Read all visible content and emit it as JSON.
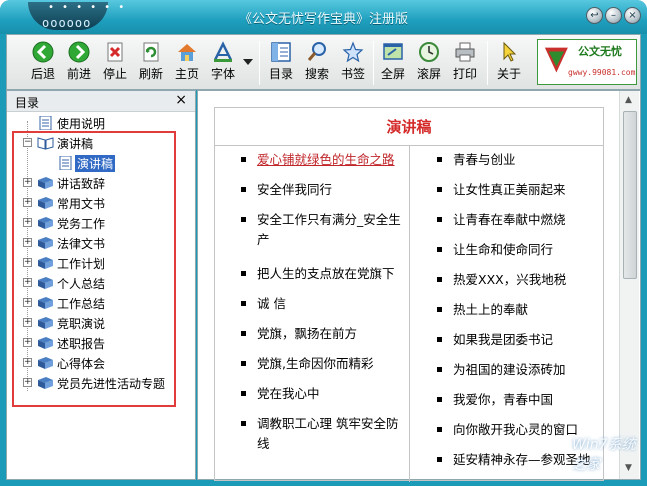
{
  "window": {
    "title": "《公文无忧写作宝典》注册版",
    "dots_top": "• • • • • •",
    "dots_bottom": "oooooo"
  },
  "window_controls": [
    {
      "name": "back-circle",
      "glyph": "↩"
    },
    {
      "name": "minimize",
      "glyph": "–"
    },
    {
      "name": "close",
      "glyph": "×"
    }
  ],
  "toolbar": {
    "buttons": [
      {
        "label": "后退",
        "icon": "back-arrow-icon"
      },
      {
        "label": "前进",
        "icon": "forward-arrow-icon"
      },
      {
        "label": "停止",
        "icon": "stop-icon"
      },
      {
        "label": "刷新",
        "icon": "refresh-icon"
      },
      {
        "label": "主页",
        "icon": "home-icon"
      },
      {
        "label": "字体",
        "icon": "font-icon"
      },
      {
        "label": "目录",
        "icon": "contents-icon"
      },
      {
        "label": "搜索",
        "icon": "search-icon"
      },
      {
        "label": "书签",
        "icon": "bookmark-star-icon"
      },
      {
        "label": "全屏",
        "icon": "fullscreen-icon"
      },
      {
        "label": "滚屏",
        "icon": "autoscroll-clock-icon"
      },
      {
        "label": "打印",
        "icon": "printer-icon"
      },
      {
        "label": "关于",
        "icon": "cursor-about-icon"
      }
    ],
    "logo": {
      "text": "公文无忧",
      "url_text": "gwwy.99081.com"
    }
  },
  "sidebar": {
    "title": "目录",
    "close_glyph": "×",
    "items": [
      {
        "label": "使用说明",
        "type": "page"
      },
      {
        "label": "演讲稿",
        "type": "book-open",
        "expanded": true
      },
      {
        "label": "演讲稿",
        "type": "page",
        "selected": true
      },
      {
        "label": "讲话致辞",
        "type": "book"
      },
      {
        "label": "常用文书",
        "type": "book"
      },
      {
        "label": "党务工作",
        "type": "book"
      },
      {
        "label": "法律文书",
        "type": "book"
      },
      {
        "label": "工作计划",
        "type": "book"
      },
      {
        "label": "个人总结",
        "type": "book"
      },
      {
        "label": "工作总结",
        "type": "book"
      },
      {
        "label": "竞职演说",
        "type": "book"
      },
      {
        "label": "述职报告",
        "type": "book"
      },
      {
        "label": "心得体会",
        "type": "book"
      },
      {
        "label": "党员先进性活动专题",
        "type": "book"
      }
    ]
  },
  "document": {
    "title": "演讲稿",
    "left_column": [
      {
        "text": "爱心铺就绿色的生命之路",
        "link": true
      },
      {
        "text": "安全伴我同行"
      },
      {
        "text": "安全工作只有满分_安全生",
        "text2": "产"
      },
      {
        "text": "把人生的支点放在党旗下"
      },
      {
        "text": "诚  信"
      },
      {
        "text": "党旗，飘扬在前方"
      },
      {
        "text": "党旗,生命因你而精彩"
      },
      {
        "text": "党在我心中"
      },
      {
        "text": "调教职工心理  筑牢安全防",
        "text2": "线"
      }
    ],
    "right_column": [
      {
        "text": "青春与创业"
      },
      {
        "text": "让女性真正美丽起来"
      },
      {
        "text": "让青春在奉献中燃烧"
      },
      {
        "text": "让生命和使命同行"
      },
      {
        "text": "热爱XXX，兴我地税"
      },
      {
        "text": "热土上的奉献"
      },
      {
        "text": "如果我是团委书记"
      },
      {
        "text": "为祖国的建设添砖加"
      },
      {
        "text": "我爱你，青春中国"
      },
      {
        "text": "向你敞开我心灵的窗口"
      },
      {
        "text": "延安精神永存—参观圣地"
      }
    ]
  },
  "watermark": "Win7系统之家"
}
